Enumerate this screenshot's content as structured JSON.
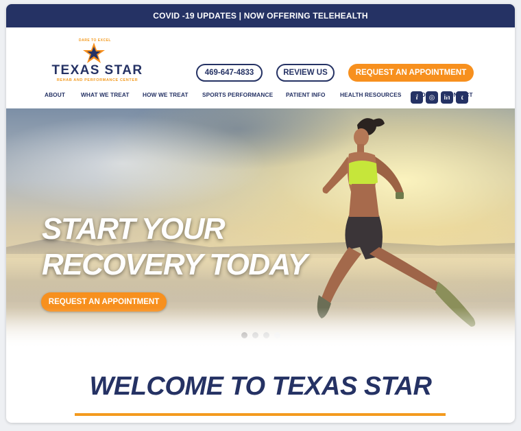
{
  "topbar": {
    "text": "COVID -19 UPDATES | NOW OFFERING TELEHEALTH"
  },
  "logo": {
    "name": "TEXAS STAR",
    "subtitle": "REHAB AND PERFORMANCE CENTER",
    "tagline": "DARE TO EXCEL"
  },
  "header": {
    "phone_label": "469-647-4833",
    "review_label": "REVIEW US",
    "appointment_label": "REQUEST AN APPOINTMENT"
  },
  "social": [
    {
      "icon": "facebook-icon",
      "glyph": "f"
    },
    {
      "icon": "instagram-icon",
      "glyph": "◎"
    },
    {
      "icon": "linkedin-icon",
      "glyph": "in"
    },
    {
      "icon": "twitter-icon",
      "glyph": "t"
    }
  ],
  "nav": {
    "items": [
      "ABOUT",
      "WHAT WE TREAT",
      "HOW WE TREAT",
      "SPORTS PERFORMANCE",
      "PATIENT INFO",
      "HEALTH RESOURCES",
      "BLOG",
      "CONTACT"
    ]
  },
  "hero": {
    "headline_line1": "START YOUR",
    "headline_line2": "RECOVERY TODAY",
    "button_label": "REQUEST AN APPOINTMENT",
    "slides": 4,
    "active_slide": 1
  },
  "welcome": {
    "title": "WELCOME TO TEXAS STAR"
  },
  "colors": {
    "navy": "#253264",
    "orange": "#f7901e"
  }
}
